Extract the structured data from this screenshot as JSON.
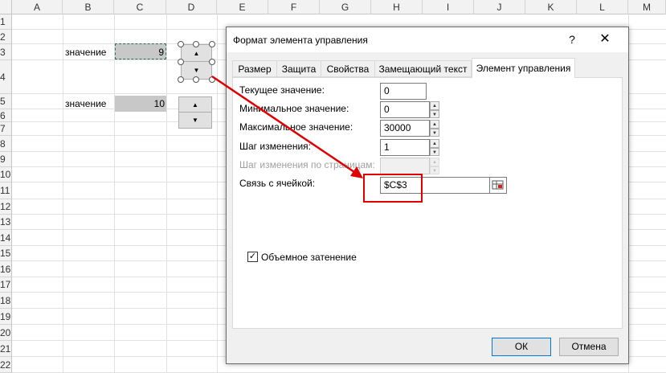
{
  "sheet": {
    "columns": [
      "A",
      "B",
      "C",
      "D",
      "E",
      "F",
      "G",
      "H",
      "I",
      "J",
      "K",
      "L",
      "M"
    ],
    "rows": [
      "1",
      "2",
      "3",
      "4",
      "5",
      "6",
      "7",
      "8",
      "9",
      "10",
      "11",
      "12",
      "13",
      "14",
      "15",
      "16",
      "17",
      "18",
      "19",
      "20",
      "21",
      "22"
    ],
    "cells": {
      "b3": "значение",
      "c3": "9",
      "b5": "значение",
      "c5": "10"
    }
  },
  "dialog": {
    "title": "Формат элемента управления",
    "help": "?",
    "close": "✕",
    "tabs": [
      "Размер",
      "Защита",
      "Свойства",
      "Замещающий текст",
      "Элемент управления"
    ],
    "active_tab": "Элемент управления",
    "fields": {
      "current_value": {
        "label": "Текущее значение:",
        "value": "0"
      },
      "min_value": {
        "label": "Минимальное значение:",
        "value": "0"
      },
      "max_value": {
        "label": "Максимальное значение:",
        "value": "30000"
      },
      "step": {
        "label": "Шаг изменения:",
        "value": "1"
      },
      "page_step": {
        "label": "Шаг изменения по страницам:",
        "value": ""
      },
      "cell_link": {
        "label": "Связь с ячейкой:",
        "value": "$C$3"
      }
    },
    "shading": {
      "label": "Объемное затенение",
      "checked": true,
      "mark": "✓"
    },
    "ok_label": "ОК",
    "cancel_label": "Отмена"
  },
  "colors": {
    "accent": "#217346",
    "highlight": "#e00000",
    "cell_fill": "#c8c8c8"
  }
}
